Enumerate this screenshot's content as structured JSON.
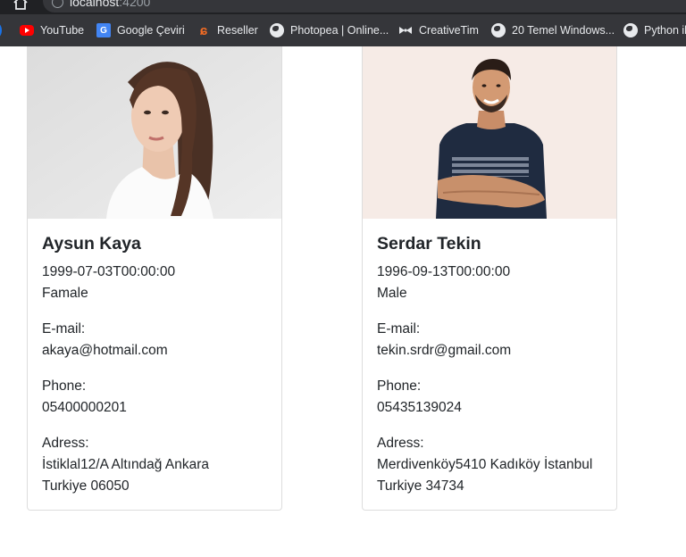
{
  "browser": {
    "url_host": "localhost",
    "url_port": ":4200",
    "bookmarks": [
      {
        "label": "YouTube",
        "icon": "youtube-icon"
      },
      {
        "label": "Google Çeviri",
        "icon": "google-translate-icon"
      },
      {
        "label": "Reseller",
        "icon": "reseller-icon"
      },
      {
        "label": "Photopea | Online...",
        "icon": "globe-icon"
      },
      {
        "label": "CreativeTim",
        "icon": "bowtie-icon"
      },
      {
        "label": "20 Temel Windows...",
        "icon": "globe-icon"
      },
      {
        "label": "Python il",
        "icon": "globe-icon"
      }
    ]
  },
  "cards": [
    {
      "name": "Aysun Kaya",
      "birth_date": "1999-07-03T00:00:00",
      "gender": "Famale",
      "email_label": "E-mail:",
      "email": "akaya@hotmail.com",
      "phone_label": "Phone:",
      "phone": "05400000201",
      "address_label": "Adress:",
      "address_line1": "İstiklal12/A Altındağ Ankara",
      "address_line2": "Turkiye 06050"
    },
    {
      "name": "Serdar Tekin",
      "birth_date": "1996-09-13T00:00:00",
      "gender": "Male",
      "email_label": "E-mail:",
      "email": "tekin.srdr@gmail.com",
      "phone_label": "Phone:",
      "phone": "05435139024",
      "address_label": "Adress:",
      "address_line1": "Merdivenköy5410 Kadıköy İstanbul",
      "address_line2": "Turkiye 34734"
    }
  ],
  "colors": {
    "chrome_dark": "#202124",
    "bookmark_bar": "#35363a",
    "text": "#212529",
    "card_border": "#dddddd"
  }
}
